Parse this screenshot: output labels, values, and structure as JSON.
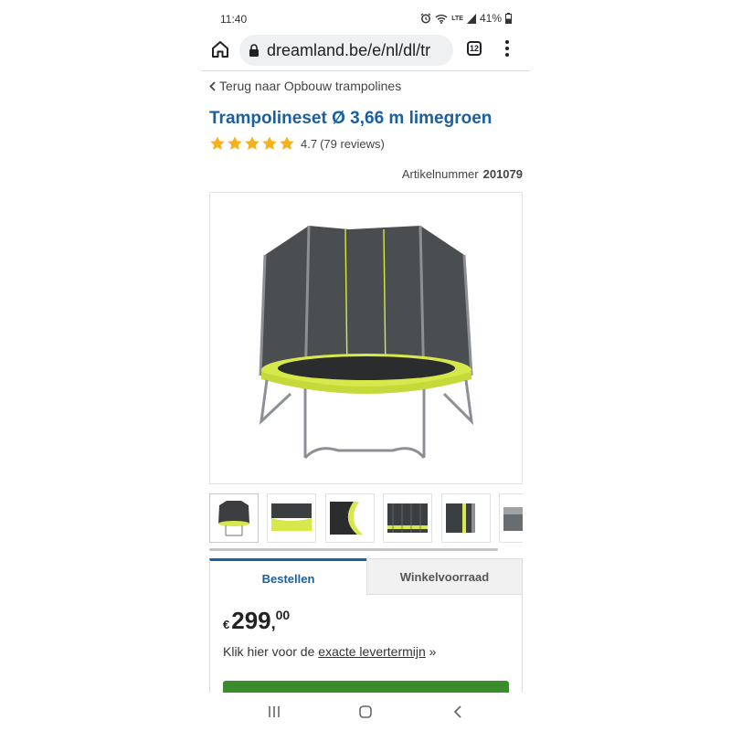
{
  "status_bar": {
    "time": "11:40",
    "battery": "41%",
    "network": "LTE",
    "icons": [
      "alarm-icon",
      "wifi-icon",
      "signal-icon",
      "battery-icon"
    ]
  },
  "browser": {
    "url": "dreamland.be/e/nl/dl/tr",
    "tab_count": "12",
    "icons": [
      "home-icon",
      "lock-icon",
      "tabs-icon",
      "more-vert-icon"
    ]
  },
  "breadcrumb": {
    "back_label": "Terug naar Opbouw trampolines"
  },
  "product": {
    "title": "Trampolineset Ø 3,66 m limegroen",
    "rating_value": "4.7",
    "rating_count": "(79 reviews)",
    "stars": 5,
    "article_label": "Artikelnummer",
    "article_number": "201079"
  },
  "gallery": {
    "thumbnail_count": 6,
    "colors": {
      "net": "#3c3f42",
      "frame": "#8c9094",
      "pad": "#d6e84a",
      "mat": "#2a2c2e"
    }
  },
  "tabs": [
    {
      "label": "Bestellen",
      "active": true
    },
    {
      "label": "Winkelvoorraad",
      "active": false
    }
  ],
  "order": {
    "currency": "€",
    "price_main": "299",
    "price_sep": ",",
    "price_cents": "00",
    "delivery_prefix": "Klik hier voor de",
    "delivery_link": "exacte levertermijn",
    "delivery_suffix": "»",
    "cta_color": "#3b8c2c"
  },
  "theme": {
    "accent": "#1a5fa0",
    "star_color": "#f5b21b"
  },
  "nav_bar": {
    "icons": [
      "recent-apps-icon",
      "home-nav-icon",
      "back-nav-icon"
    ]
  }
}
